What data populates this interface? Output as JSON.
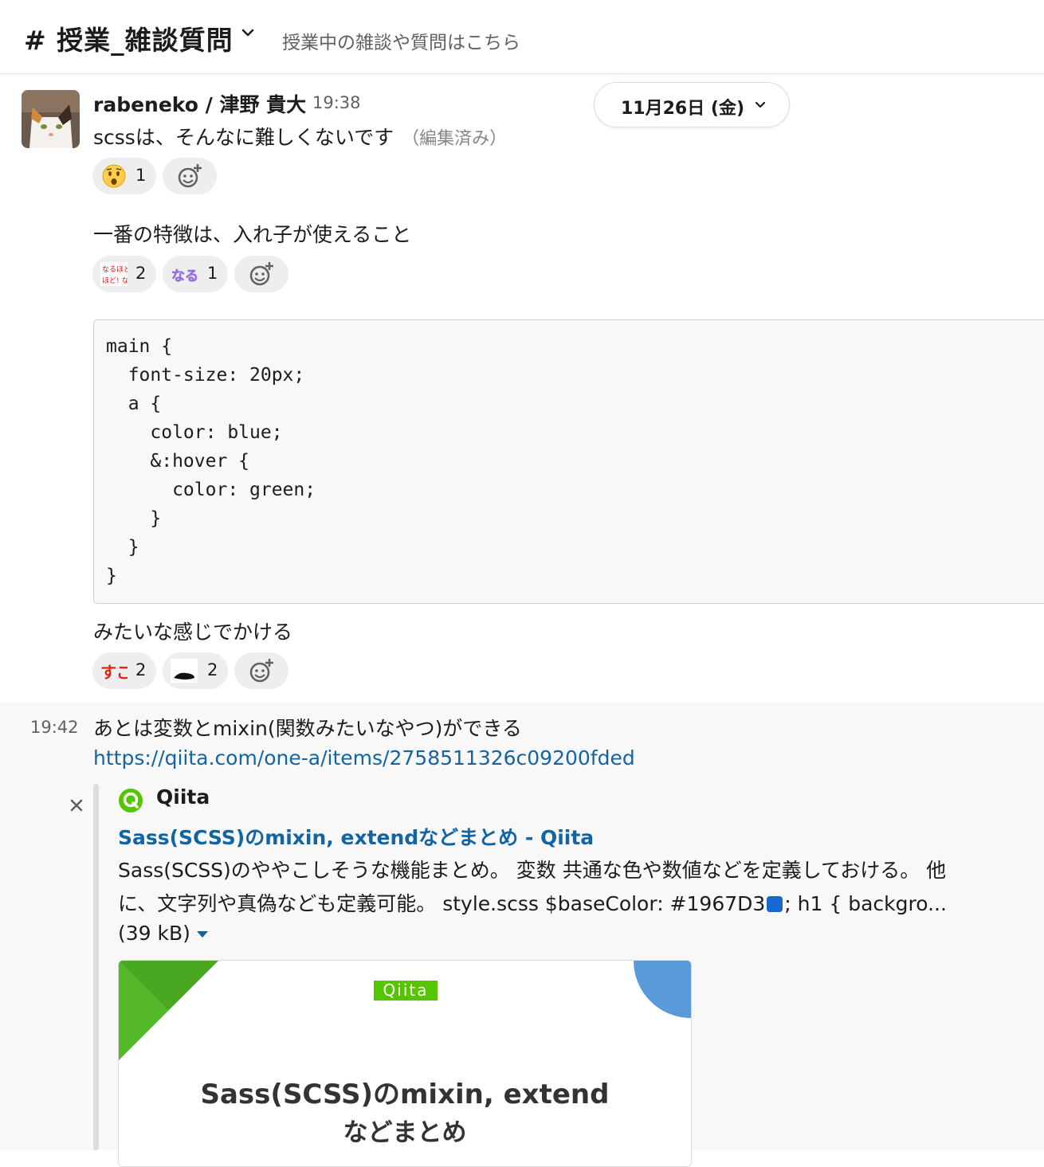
{
  "header": {
    "channel_name": "# 授業_雑談質問",
    "topic": "授業中の雑談や質問はこちら"
  },
  "date_divider": "11月26日 (金)",
  "message1": {
    "author": "rabeneko / 津野 貴大",
    "time": "19:38",
    "text": "scssは、そんなに難しくないです",
    "edited": "（編集済み）",
    "reactions": [
      {
        "emoji": "astonished",
        "count": "1"
      }
    ]
  },
  "message2": {
    "text": "一番の特徴は、入れ子が使えること",
    "reactions": [
      {
        "emoji": "naruhodo-custom-red",
        "count": "2"
      },
      {
        "emoji": "naruhodo-custom-purple",
        "count": "1"
      }
    ]
  },
  "code": {
    "lines": [
      "main {",
      "  font-size: 20px;",
      "  a {",
      "    color: blue;",
      "    &:hover {",
      "      color: green;",
      "    }",
      "  }",
      "}"
    ]
  },
  "message3": {
    "text": "みたいな感じでかける",
    "reactions": [
      {
        "emoji": "sugoi-custom",
        "count": "2"
      },
      {
        "emoji": "custom-black-blob",
        "count": "2"
      }
    ]
  },
  "message4": {
    "time": "19:42",
    "text": "あとは変数とmixin(関数みたいなやつ)ができる",
    "link": "https://qiita.com/one-a/items/2758511326c09200fded"
  },
  "unfurl": {
    "site": "Qiita",
    "title": "Sass(SCSS)のmixin, extendなどまとめ - Qiita",
    "desc_line1": "Sass(SCSS)のややこしそうな機能まとめ。 変数 共通な色や数値などを定義しておける。 他",
    "desc_line2_a": "に、文字列や真偽なども定義可能。 style.scss $baseColor: #1967D3",
    "desc_line2_b": "; h1 { backgro...",
    "size": "(39 kB)",
    "preview": {
      "logo": "Qiita",
      "title_line1": "Sass(SCSS)のmixin, extend",
      "title_line2": "などまとめ"
    }
  },
  "colors": {
    "link": "#1264a3",
    "swatch": "#1967D3",
    "qiita_green": "#55c500",
    "preview_blue": "#5a9ad8"
  }
}
